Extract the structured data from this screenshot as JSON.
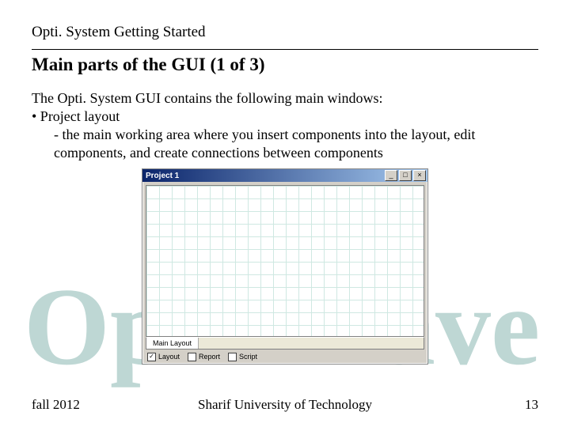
{
  "header": "Opti. System Getting Started",
  "title": "Main parts of the GUI (1 of 3)",
  "body": {
    "intro": "The Opti. System GUI contains the following main windows:",
    "bullet": "• Project layout",
    "desc": "- the main working area where you insert components into the layout, edit components, and create connections between components"
  },
  "window": {
    "caption": "Project 1",
    "btn_min": "_",
    "btn_max": "□",
    "btn_close": "×",
    "tab_main": "Main Layout",
    "chk_layout": "Layout",
    "chk_report": "Report",
    "chk_script": "Script",
    "check_mark": "✓"
  },
  "footer": {
    "left": "fall 2012",
    "center": "Sharif University of Technology",
    "right": "13"
  },
  "logo": {
    "text_left": "Op",
    "text_right": "ave"
  }
}
